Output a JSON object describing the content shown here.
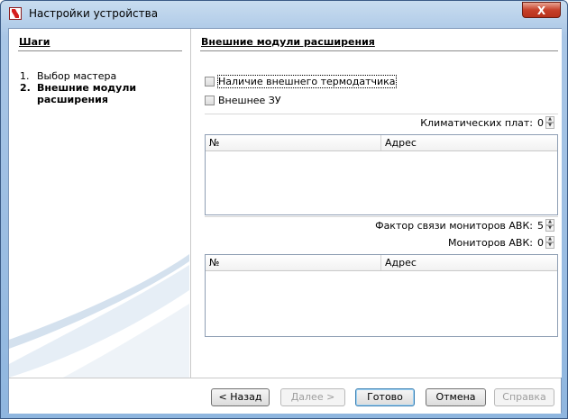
{
  "window": {
    "title": "Настройки устройства",
    "close_symbol": "X"
  },
  "steps": {
    "title": "Шаги",
    "items": [
      {
        "num": "1.",
        "label": "Выбор мастера"
      },
      {
        "num": "2.",
        "label": "Внешние модули расширения"
      }
    ]
  },
  "content": {
    "title": "Внешние модули расширения",
    "checkbox_thermo": {
      "label": "Наличие внешнего термодатчика",
      "checked": false
    },
    "checkbox_charger": {
      "label": "Внешнее ЗУ",
      "checked": false
    },
    "climate_boards": {
      "label": "Климатических плат:",
      "value": "0"
    },
    "table1": {
      "columns": [
        "№",
        "Адрес"
      ],
      "rows": []
    },
    "avk_link_factor": {
      "label": "Фактор связи мониторов АВК:",
      "value": "5"
    },
    "avk_monitors": {
      "label": "Мониторов АВК:",
      "value": "0"
    },
    "table2": {
      "columns": [
        "№",
        "Адрес"
      ],
      "rows": []
    }
  },
  "buttons": {
    "back": "< Назад",
    "next": "Далее >",
    "finish": "Готово",
    "cancel": "Отмена",
    "help": "Справка"
  },
  "colors": {
    "accent_red": "#d51f1f",
    "title_bar": "#a9c6e6",
    "close_button": "#c7412b"
  }
}
